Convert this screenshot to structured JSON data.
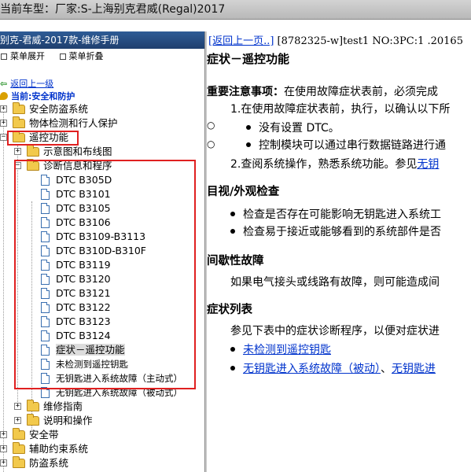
{
  "header": {
    "vehicle_label": "当前车型：",
    "vehicle_value": "厂家:S-上海别克君威(Regal)2017"
  },
  "manual": {
    "title": "别克-君威-2017款-维修手册",
    "expand_label": "菜单展开",
    "collapse_label": "菜单折叠",
    "back_label": "返回上一级",
    "current_label": "当前:安全和防护"
  },
  "tree": {
    "n0": "安全防盗系统",
    "n1": "物体检测和行人保护",
    "n2": "遥控功能",
    "n3": "示意图和布线图",
    "n4": "诊断信息和程序",
    "d0": "DTC B305D",
    "d1": "DTC B3101",
    "d2": "DTC B3105",
    "d3": "DTC B3106",
    "d4": "DTC B3109-B3113",
    "d5": "DTC B310D-B310F",
    "d6": "DTC B3119",
    "d7": "DTC B3120",
    "d8": "DTC B3121",
    "d9": "DTC B3122",
    "d10": "DTC B3123",
    "d11": "DTC B3124",
    "d12": "症状－遥控功能",
    "d13": "未检测到遥控钥匙",
    "d14": "无钥匙进入系统故障（主动式）",
    "d15": "无钥匙进入系统故障（被动式）",
    "n5": "维修指南",
    "n6": "说明和操作",
    "n7": "安全带",
    "n8": "辅助约束系统",
    "n9": "防盗系统"
  },
  "content": {
    "back_link": "[返回上一页..]",
    "doc_ref": " [8782325-w]test1 NO:3PC:1 .20165",
    "title": "症状－遥控功能",
    "notice_heading": "重要注意事项：",
    "notice_text": "在使用故障症状表前，必须完成",
    "step1": "1.在使用故障症状表前，执行，以确认以下所",
    "bullet1": "没有设置 DTC。",
    "bullet2": "控制模块可以通过串行数据链路进行通",
    "step2_text": "2.查阅系统操作，熟悉系统功能。参见",
    "step2_link": "无钥",
    "visual_heading": "目视/外观检查",
    "visual1": "检查是否存在可能影响无钥匙进入系统工",
    "visual2": "检查易于接近或能够看到的系统部件是否",
    "intermittent_heading": "间歇性故障",
    "intermittent_text": "如果电气接头或线路有故障，则可能造成间",
    "symptom_heading": "症状列表",
    "symptom_text": "参见下表中的症状诊断程序，以便对症状进",
    "link1": "未检测到遥控钥匙",
    "link2": "无钥匙进入系统故障（被动）",
    "link_sep": "、",
    "link3": "无钥匙进"
  },
  "colors": {
    "accent_blue": "#1f3f6e",
    "link": "#0033cc",
    "highlight": "#e02020",
    "folder": "#f2c94c"
  }
}
